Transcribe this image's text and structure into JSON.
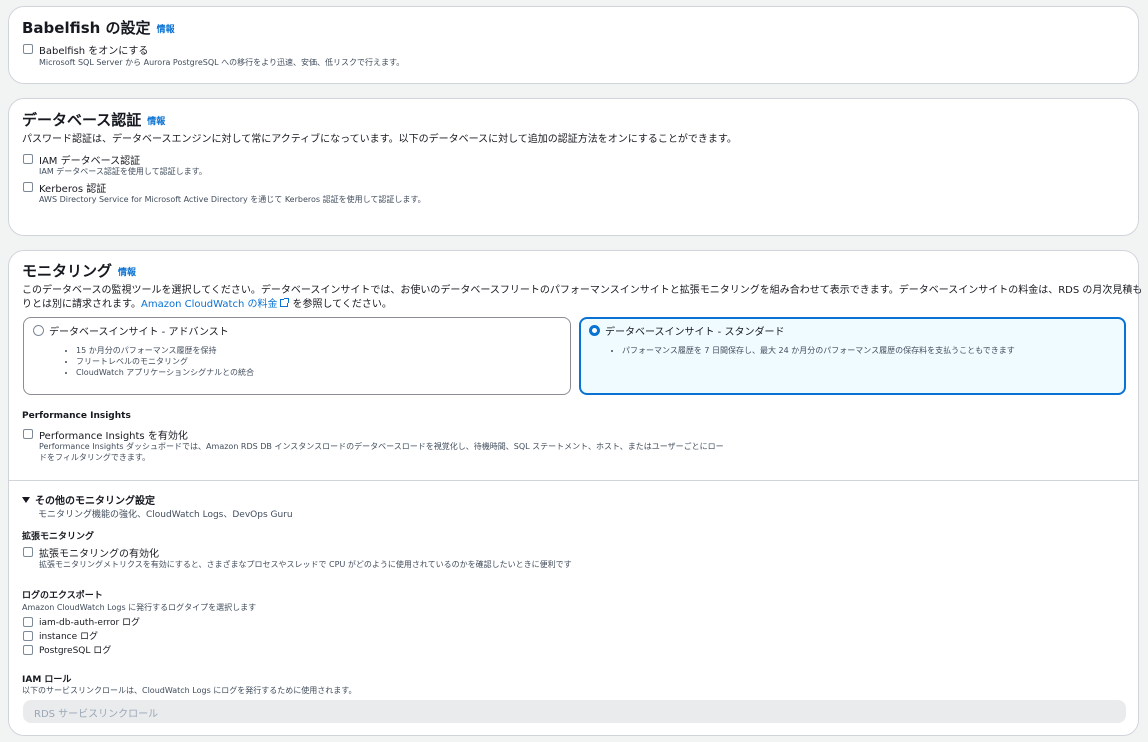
{
  "babelfish": {
    "title": "Babelfish の設定",
    "info": "情報",
    "checkbox_label": "Babelfish をオンにする",
    "checkbox_desc": "Microsoft SQL Server から Aurora PostgreSQL への移行をより迅速、安価、低リスクで行えます。"
  },
  "db_auth": {
    "title": "データベース認証",
    "info": "情報",
    "desc": "パスワード認証は、データベースエンジンに対して常にアクティブになっています。以下のデータベースに対して追加の認証方法をオンにすることができます。",
    "options": [
      {
        "label": "IAM データベース認証",
        "desc": "IAM データベース認証を使用して認証します。"
      },
      {
        "label": "Kerberos 認証",
        "desc": "AWS Directory Service for Microsoft Active Directory を通じて Kerberos 認証を使用して認証します。"
      }
    ]
  },
  "monitoring": {
    "title": "モニタリング",
    "info": "情報",
    "desc_line1": "このデータベースの監視ツールを選択してください。データベースインサイトでは、お使いのデータベースフリートのパフォーマンスインサイトと拡張モニタリングを組み合わせて表示できます。データベースインサイトの料金は、RDS の月次見積も",
    "desc_line2_pre": "りとは別に請求されます。",
    "desc_link": "Amazon CloudWatch の料金",
    "desc_line2_post": "を参照してください。",
    "tiles": [
      {
        "title": "データベースインサイト - アドバンスト",
        "selected": false,
        "bullets": [
          "15 か月分のパフォーマンス履歴を保持",
          "フリートレベルのモニタリング",
          "CloudWatch アプリケーションシグナルとの統合"
        ]
      },
      {
        "title": "データベースインサイト - スタンダード",
        "selected": true,
        "bullets": [
          "パフォーマンス履歴を 7 日間保存し、最大 24 か月分のパフォーマンス履歴の保存料を支払うこともできます"
        ]
      }
    ],
    "pi_heading": "Performance Insights",
    "pi_checkbox_label": "Performance Insights を有効化",
    "pi_desc_line1": "Performance Insights ダッシュボードでは、Amazon RDS DB インスタンスロードのデータベースロードを視覚化し、待機時間、SQL ステートメント、ホスト、またはユーザーごとにロー",
    "pi_desc_line2": "ドをフィルタリングできます。",
    "additional": {
      "title": "その他のモニタリング設定",
      "subtitle": "モニタリング機能の強化、CloudWatch Logs、DevOps Guru",
      "enhanced_heading": "拡張モニタリング",
      "enhanced_checkbox": "拡張モニタリングの有効化",
      "enhanced_desc": "拡張モニタリングメトリクスを有効にすると、さまざまなプロセスやスレッドで CPU がどのように使用されているのかを確認したいときに便利です",
      "log_heading": "ログのエクスポート",
      "log_desc": "Amazon CloudWatch Logs に発行するログタイプを選択します",
      "logs": [
        "iam-db-auth-error ログ",
        "instance ログ",
        "PostgreSQL ログ"
      ],
      "iam_heading": "IAM ロール",
      "iam_desc": "以下のサービスリンクロールは、CloudWatch Logs にログを発行するために使用されます。",
      "iam_placeholder": "RDS サービスリンクロール"
    }
  }
}
